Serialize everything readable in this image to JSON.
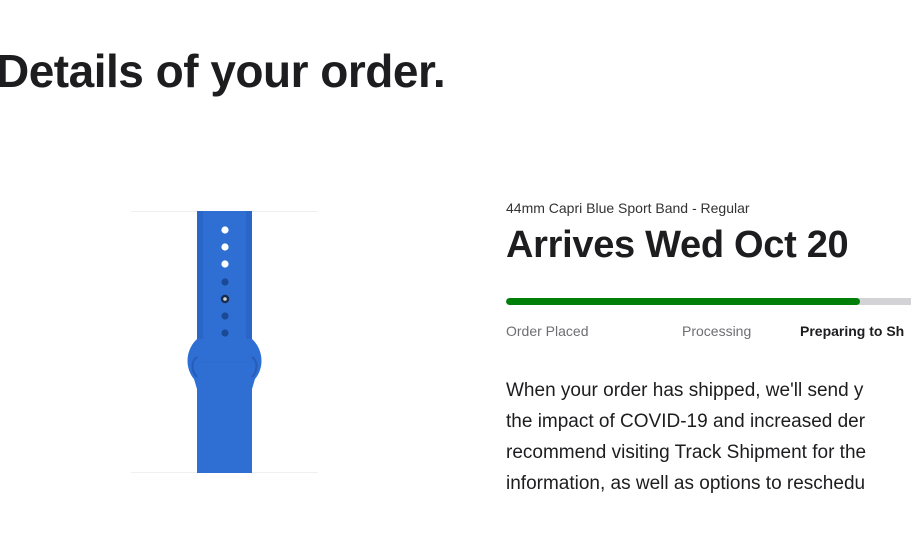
{
  "page": {
    "title": "Details of your order."
  },
  "order": {
    "product_name": "44mm Capri Blue Sport Band - Regular",
    "arrival": "Arrives Wed Oct 20",
    "progress_fraction": 0.77,
    "steps": [
      {
        "label": "Order Placed",
        "state": "complete"
      },
      {
        "label": "Processing",
        "state": "complete"
      },
      {
        "label": "Preparing to Sh",
        "state": "current"
      }
    ],
    "message_lines": [
      "When your order has shipped, we'll send y",
      "the impact of COVID-19 and increased der",
      "recommend visiting Track Shipment for the",
      "information, as well as options to reschedu"
    ]
  },
  "colors": {
    "progress_fill": "#008009",
    "progress_track": "#d2d2d7",
    "band": "#2f6fd3"
  },
  "icons": {
    "product": "watch-band-image"
  }
}
